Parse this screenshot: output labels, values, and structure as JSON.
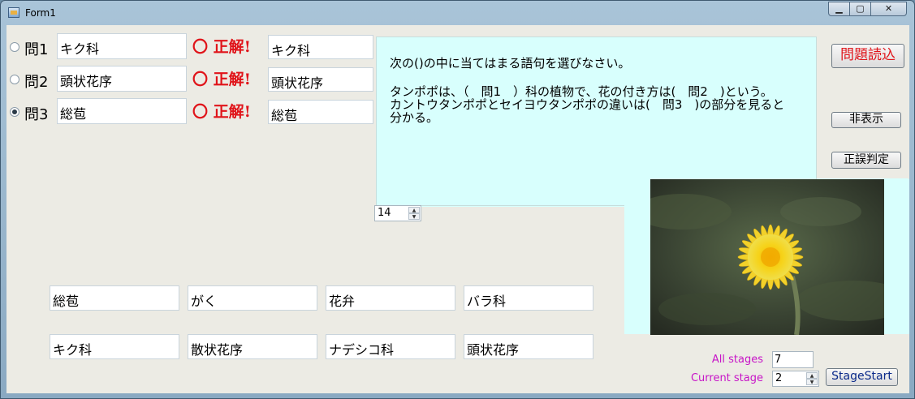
{
  "window": {
    "title": "Form1",
    "min": "▁",
    "max": "▢",
    "close": "✕"
  },
  "questions": [
    {
      "label": "問1",
      "answer": "キク科",
      "result": "〇 正解!",
      "correct": "キク科",
      "selected": false
    },
    {
      "label": "問2",
      "answer": "頭状花序",
      "result": "〇 正解!",
      "correct": "頭状花序",
      "selected": false
    },
    {
      "label": "問3",
      "answer": "総苞",
      "result": "〇 正解!",
      "correct": "総苞",
      "selected": true
    }
  ],
  "panel": {
    "instruction": "次の()の中に当てはまる語句を選びなさい。",
    "question_text": "タンポポは、（　問1　）科の植物で、花の付き方は(　問2　)という。\nカントウタンポポとセイヨウタンポポの違いは(　問3　)の部分を見ると\n分かる。"
  },
  "buttons": {
    "load": "問題読込",
    "hide": "非表示",
    "judge": "正誤判定",
    "stage_start": "StageStart"
  },
  "font_size_spinner": {
    "value": "14"
  },
  "choices": [
    "総苞",
    "がく",
    "花弁",
    "バラ科",
    "キク科",
    "散状花序",
    "ナデシコ科",
    "頭状花序"
  ],
  "stages": {
    "all_label": "All stages",
    "all_value": "7",
    "current_label": "Current stage",
    "current_value": "2"
  },
  "spin_icons": {
    "up": "▲",
    "down": "▼"
  },
  "image": {
    "subject": "dandelion-flower",
    "colors": {
      "petal": "#f5d21a",
      "background": "#3f4a36"
    }
  }
}
